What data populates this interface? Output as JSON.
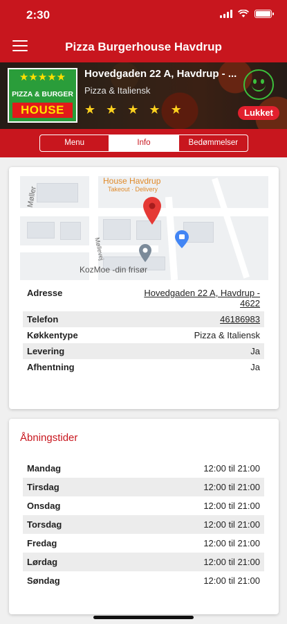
{
  "status_bar": {
    "time": "2:30"
  },
  "nav": {
    "title": "Pizza Burgerhouse Havdrup"
  },
  "hero": {
    "logo_top": "PIZZA & BURGER",
    "logo_bottom": "HOUSE",
    "address": "Hovedgaden 22 A, Havdrup - ...",
    "category": "Pizza & Italiensk",
    "rating_stars": 5,
    "status_badge": "Lukket"
  },
  "tabs": [
    {
      "label": "Menu"
    },
    {
      "label": "Info"
    },
    {
      "label": "Bedømmelser"
    }
  ],
  "active_tab": "Info",
  "map": {
    "place_name": "House Havdrup",
    "place_sub": "Takeout · Delivery",
    "poi_name": "KozMoe -din frisør",
    "street_1": "Møller",
    "street_2": "Møllevej"
  },
  "info": {
    "rows": [
      {
        "label": "Adresse",
        "value": "Hovedgaden 22 A, Havdrup - 4622"
      },
      {
        "label": "Telefon",
        "value": "46186983"
      },
      {
        "label": "Køkkentype",
        "value": "Pizza & Italiensk"
      },
      {
        "label": "Levering",
        "value": "Ja"
      },
      {
        "label": "Afhentning",
        "value": "Ja"
      }
    ]
  },
  "hours": {
    "title": "Åbningstider",
    "days": [
      {
        "day": "Mandag",
        "time": "12:00 til 21:00"
      },
      {
        "day": "Tirsdag",
        "time": "12:00 til 21:00"
      },
      {
        "day": "Onsdag",
        "time": "12:00 til 21:00"
      },
      {
        "day": "Torsdag",
        "time": "12:00 til 21:00"
      },
      {
        "day": "Fredag",
        "time": "12:00 til 21:00"
      },
      {
        "day": "Lørdag",
        "time": "12:00 til 21:00"
      },
      {
        "day": "Søndag",
        "time": "12:00 til 21:00"
      }
    ]
  },
  "colors": {
    "brand_red": "#c8161e",
    "closed_badge": "#e2202e",
    "smiley_green": "#3cc13c"
  }
}
